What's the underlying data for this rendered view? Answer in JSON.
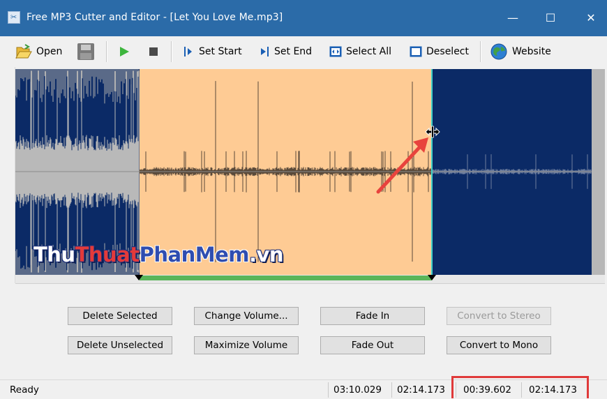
{
  "window": {
    "title": "Free MP3 Cutter and Editor - [Let You Love Me.mp3]",
    "app_icon": "mp3-cutter-app-icon"
  },
  "window_controls": {
    "minimize": "—",
    "maximize": "☐",
    "close": "✕"
  },
  "toolbar": {
    "open_label": "Open",
    "set_start_label": "Set Start",
    "set_end_label": "Set End",
    "select_all_label": "Select All",
    "deselect_label": "Deselect",
    "website_label": "Website"
  },
  "waveform": {
    "selection_color": "#fecb94",
    "wave_color": "#163675",
    "background_color": "#0b2a66",
    "played_progress_color": "#5ab55a"
  },
  "buttons": {
    "delete_selected": "Delete Selected",
    "change_volume": "Change Volume...",
    "fade_in": "Fade In",
    "convert_to_stereo": "Convert to Stereo",
    "delete_unselected": "Delete Unselected",
    "maximize_volume": "Maximize Volume",
    "fade_out": "Fade Out",
    "convert_to_mono": "Convert to Mono"
  },
  "status": {
    "state": "Ready",
    "total_length": "03:10.029",
    "selection_start": "02:14.173",
    "selection_length": "00:39.602",
    "selection_end_readout": "02:14.173"
  },
  "watermark": {
    "part1": "Thu",
    "part2": "Thuat",
    "part3": "PhanMem",
    "part4": ".vn"
  }
}
